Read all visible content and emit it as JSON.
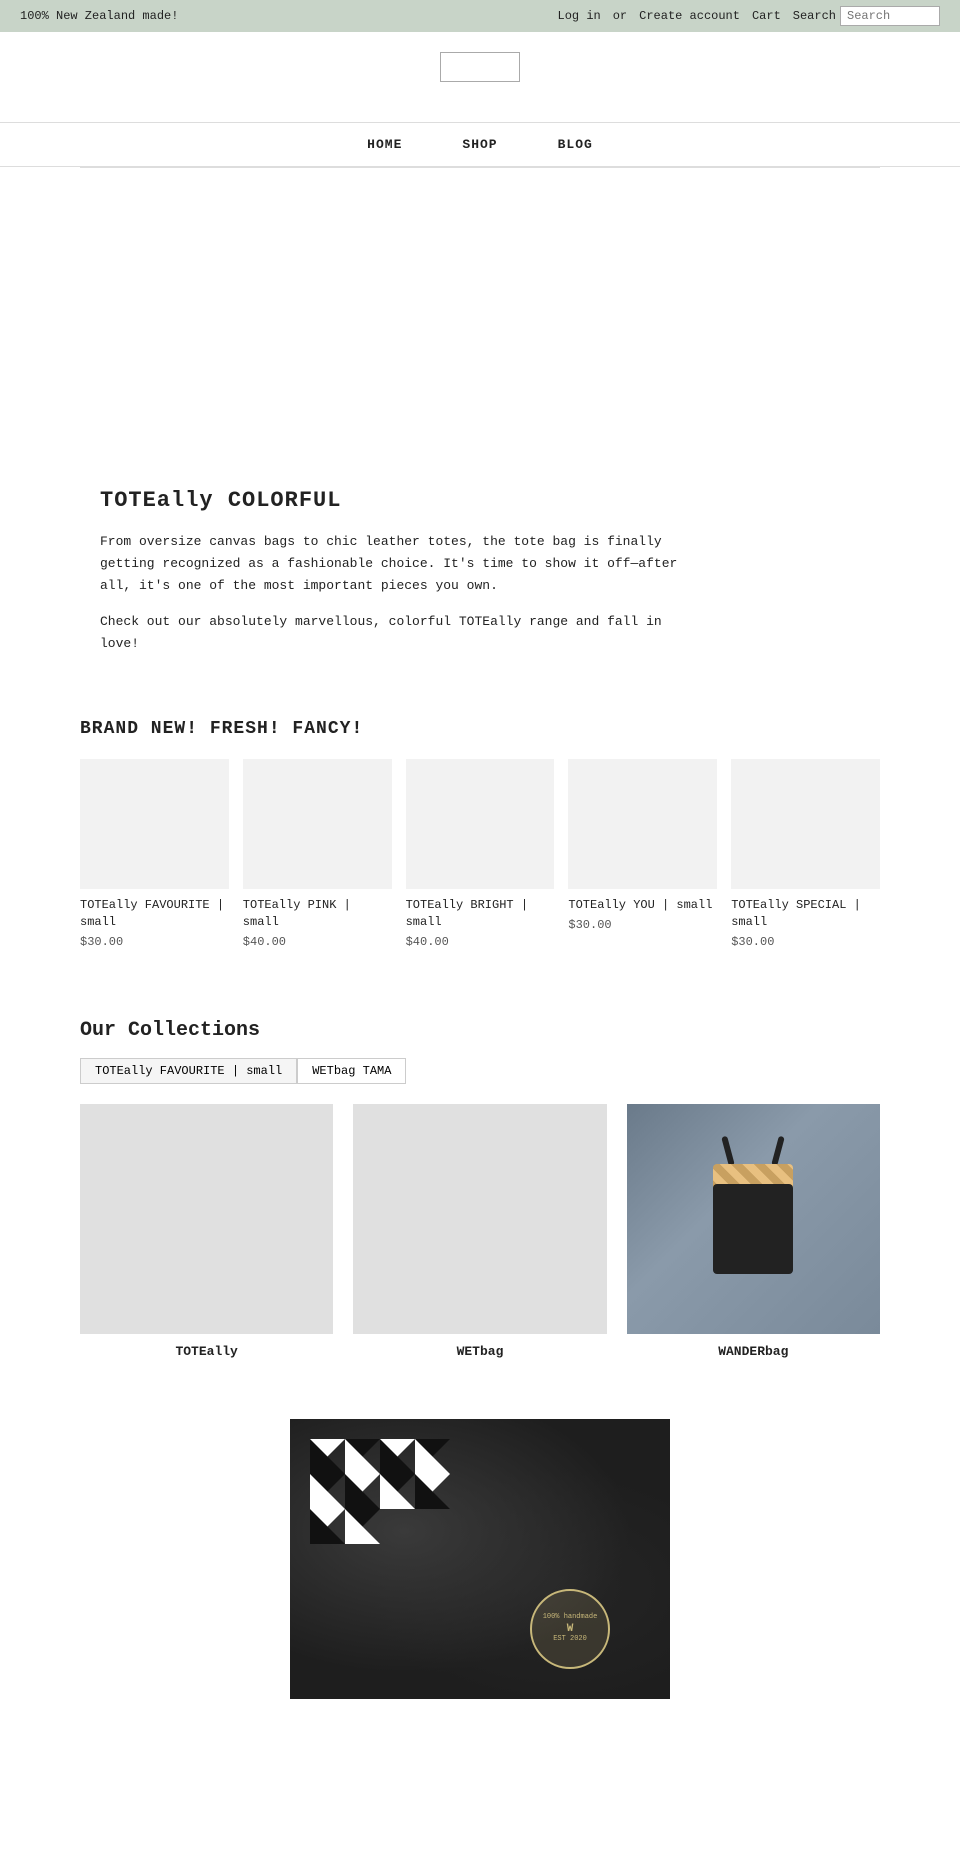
{
  "topbar": {
    "tagline": "100% New Zealand made!",
    "login_text": "Log in",
    "or_text": "or",
    "create_account_text": "Create account",
    "cart_text": "Cart",
    "search_label": "Search",
    "search_placeholder": "Search"
  },
  "nav": {
    "items": [
      {
        "label": "HOME",
        "href": "#"
      },
      {
        "label": "SHOP",
        "href": "#"
      },
      {
        "label": "BLOG",
        "href": "#"
      }
    ]
  },
  "hero": {},
  "content": {
    "heading": "TOTEally COLORFUL",
    "paragraph1": "From oversize canvas bags to chic leather totes, the tote bag is finally getting recognized as a fashionable choice. It's time to show it off—after all, it's one of the most important pieces you own.",
    "paragraph2": "Check out our absolutely marvellous, colorful TOTEally range and fall in love!"
  },
  "products": {
    "heading": "BRAND NEW! FRESH! FANCY!",
    "items": [
      {
        "name": "TOTEally FAVOURITE | small",
        "price": "$30.00"
      },
      {
        "name": "TOTEally PINK | small",
        "price": "$40.00"
      },
      {
        "name": "TOTEally BRIGHT | small",
        "price": "$40.00"
      },
      {
        "name": "TOTEally YOU | small",
        "price": "$30.00"
      },
      {
        "name": "TOTEally SPECIAL | small",
        "price": "$30.00"
      }
    ]
  },
  "collections": {
    "heading": "Our Collections",
    "tabs": [
      {
        "label": "TOTEally FAVOURITE | small"
      },
      {
        "label": "WETbag TAMA"
      }
    ],
    "items": [
      {
        "label": "TOTEally",
        "has_image": false
      },
      {
        "label": "WETbag",
        "has_image": false
      },
      {
        "label": "WANDERbag",
        "has_image": true
      }
    ]
  },
  "stamp": {
    "line1": "100% handmade",
    "line2": "EST   2020",
    "logo": "W"
  }
}
